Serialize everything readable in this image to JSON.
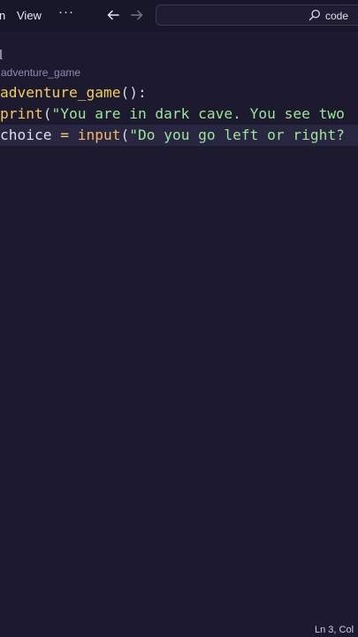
{
  "titlebar": {
    "menu_cut": "n",
    "menu_view": "View",
    "menu_more": "···",
    "search_text": "code",
    "icons": {
      "back": "arrow-left-icon",
      "forward": "arrow-right-icon",
      "search": "search-icon"
    }
  },
  "editor": {
    "breadcrumb": "adventure_game",
    "lines": [
      {
        "tokens": [
          {
            "text": "adventure_game",
            "cls": "tok-fn"
          },
          {
            "text": "():",
            "cls": "tok-paren"
          }
        ]
      },
      {
        "tokens": [
          {
            "text": "print",
            "cls": "tok-print"
          },
          {
            "text": "(",
            "cls": "tok-paren"
          },
          {
            "text": "\"You are in dark cave. You see two",
            "cls": "tok-str"
          }
        ]
      },
      {
        "tokens": [
          {
            "text": "choice",
            "cls": "tok-var"
          },
          {
            "text": " = ",
            "cls": "tok-op"
          },
          {
            "text": "input",
            "cls": "tok-input"
          },
          {
            "text": "(",
            "cls": "tok-paren"
          },
          {
            "text": "\"Do you go left or right?",
            "cls": "tok-str"
          }
        ]
      }
    ]
  },
  "status_bar": {
    "cursor": "Ln 3, Col"
  },
  "colors": {
    "background": "#1d1a2f",
    "titlebar": "#181629",
    "current_line": "#292641",
    "function": "#f0cd5e",
    "string": "#9fe49a"
  }
}
